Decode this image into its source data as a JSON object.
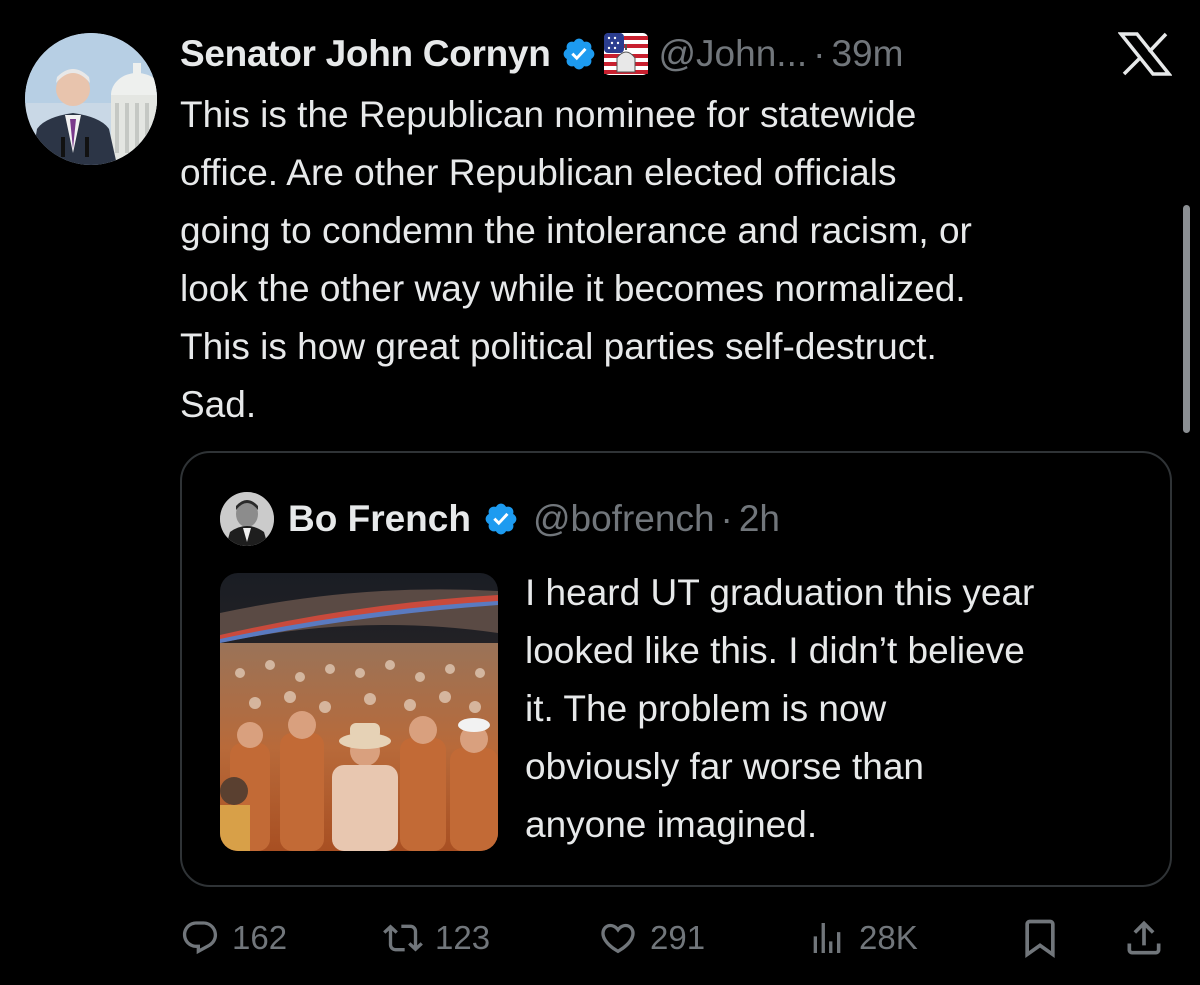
{
  "tweet": {
    "author": {
      "display_name": "Senator John Cornyn",
      "handle": "@John...",
      "avatar": "senator-portrait-capitol-avatar"
    },
    "separator": "·",
    "timestamp": "39m",
    "text": "This is the Republican nominee for statewide\noffice. Are other Republican elected officials\ngoing to condemn the intolerance and racism, or\nlook the other way while it becomes normalized.\nThis is how great political parties self-destruct.\nSad.",
    "badges": [
      "verified-icon",
      "us-capitol-flag-badge"
    ]
  },
  "quoted_tweet": {
    "author": {
      "display_name": "Bo French",
      "handle": "@bofrench",
      "avatar": "bo-french-avatar"
    },
    "separator": "·",
    "timestamp": "2h",
    "text": "I heard UT graduation this year\nlooked like this. I didn’t believe\nit. The problem is now\nobviously far worse than\nanyone imagined.",
    "media": "stadium-crowd-photo"
  },
  "actions": {
    "replies": "162",
    "reposts": "123",
    "likes": "291",
    "views": "28K"
  },
  "colors": {
    "background": "#000000",
    "text": "#e7e9ea",
    "secondary": "#71767b",
    "verified_blue": "#1d9bf0",
    "border": "#2f3336"
  },
  "icons": [
    "x-logo-icon",
    "reply-icon",
    "repost-icon",
    "like-icon",
    "views-icon",
    "bookmark-icon",
    "share-icon"
  ]
}
